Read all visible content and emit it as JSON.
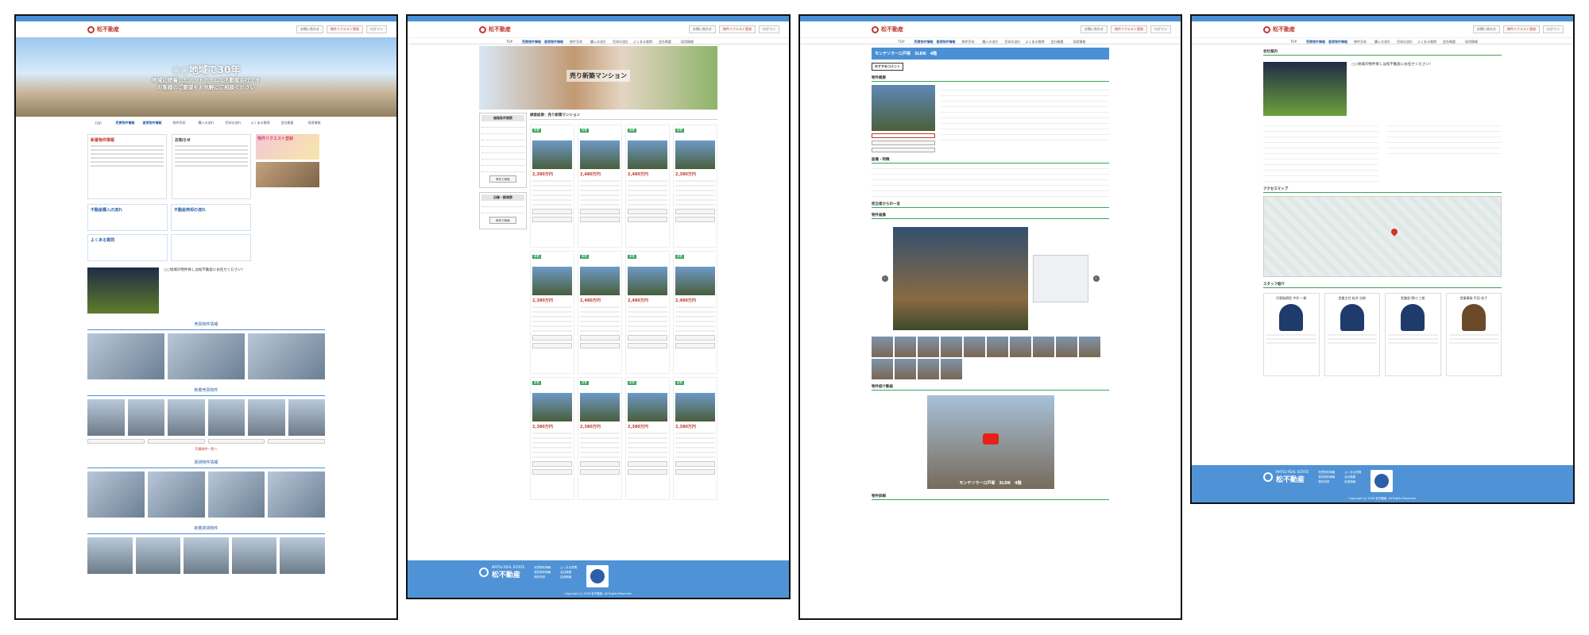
{
  "site": {
    "logo_text": "松不動産",
    "header_buttons": [
      "お問い合わせ",
      "物件リクエスト登録",
      "ログイン"
    ],
    "nav": [
      "TOP",
      "売買物件情報",
      "賃貸物件情報",
      "物件売却",
      "購入の流れ",
      "売却の流れ",
      "よくある質問",
      "会社概要",
      "採用情報"
    ],
    "footer": {
      "brand_en": "MATSU REAL ESTATE",
      "brand_ja": "松不動産",
      "copyright": "Copyright (c) 2018 松不動産. All Rights Reserved."
    }
  },
  "panel1": {
    "hero_title": "○○地域で30年",
    "hero_sub_1": "地域に密着したアットホームな不動産会社です",
    "hero_sub_2": "お客様のご要望をお気軽にご相談ください",
    "news_title": "新着物件情報",
    "info_title": "お知らせ",
    "banner_request": "物件リクエスト登録",
    "flow_buy": "不動産購入の流れ",
    "flow_sell": "不動産売却の流れ",
    "faq": "よくある質問",
    "greeting": "○○地域の物件探しは松不動産にお任せください！",
    "section_sale": "売買物件情報",
    "section_new": "新着売買物件",
    "section_rent": "賃貸物件情報",
    "section_new_rent": "新着賃貸物件",
    "more": "売買物件一覧へ"
  },
  "panel2": {
    "hero_title": "売り新築マンション",
    "side_head_1": "価格条件検索",
    "side_head_2": "沿線・駅検索",
    "side_search_btn": "条件で検索",
    "main_heading": "検索結果：売り新築マンション",
    "cards": [
      {
        "badge": "新着",
        "price": "2,380万円"
      },
      {
        "badge": "新着",
        "price": "2,480万円"
      },
      {
        "badge": "新着",
        "price": "2,480万円"
      },
      {
        "badge": "新着",
        "price": "2,380万円"
      },
      {
        "badge": "新着",
        "price": "2,380万円"
      },
      {
        "badge": "新着",
        "price": "2,480万円"
      },
      {
        "badge": "新着",
        "price": "2,480万円"
      },
      {
        "badge": "新着",
        "price": "2,480万円"
      },
      {
        "badge": "新着",
        "price": "2,380万円"
      },
      {
        "badge": "新着",
        "price": "2,380万円"
      },
      {
        "badge": "新着",
        "price": "2,380万円"
      },
      {
        "badge": "新着",
        "price": "2,380万円"
      }
    ]
  },
  "panel3": {
    "title": "モンテソラーロ戸塚　3LDK　4階",
    "recommend": "おすすめコメント",
    "overview": "物件概要",
    "features": "設備・特徴",
    "staff_comment": "担当者からの一言",
    "photos": "物件画像",
    "movie": "物件紹介動画",
    "video_caption": "モンテソラーロ戸塚　3LDK　4階",
    "details": "物件詳細"
  },
  "panel4": {
    "company": "会社案内",
    "ceo_msg": "○○地域の物件探しは松不動産にお任せください！",
    "access": "アクセスマップ",
    "staff_title": "スタッフ紹介",
    "staff": [
      "代表取締役 中井 一郎",
      "営業主任 松井 次郎",
      "営業部 野口 三郎",
      "営業事務 平田 花子"
    ]
  }
}
